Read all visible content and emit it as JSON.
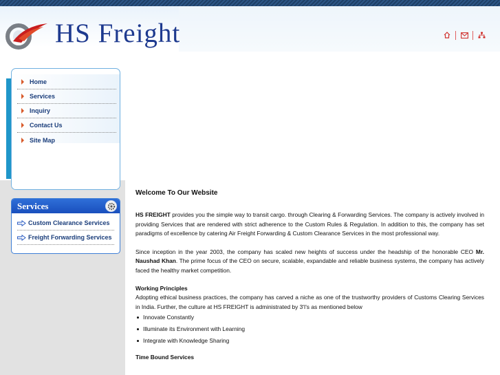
{
  "brand": {
    "name": "HS Freight",
    "logo": "hs-freight-swoosh-logo"
  },
  "header_icons": [
    {
      "name": "home-icon"
    },
    {
      "name": "mail-icon"
    },
    {
      "name": "sitemap-icon"
    }
  ],
  "nav": {
    "items": [
      {
        "label": "Home"
      },
      {
        "label": "Services"
      },
      {
        "label": "Inquiry"
      },
      {
        "label": "Contact Us"
      },
      {
        "label": "Site Map"
      }
    ]
  },
  "services_box": {
    "title": "Services",
    "icon": "gear-icon",
    "items": [
      {
        "label": "Custom Clearance Services"
      },
      {
        "label": "Freight Forwarding Services"
      }
    ]
  },
  "main": {
    "heading": "Welcome To Our Website",
    "p1_bold": "HS FREIGHT",
    "p1_text": " provides you the simple way to transit cargo. through Clearing & Forwarding Services. The company is actively involved in providing Services that are rendered with strict adherence to the Custom Rules & Regulation. In addition to this, the company has set paradigms of excellence by catering Air Freight Forwarding & Custom Clearance Services in the most professional way.",
    "p2_text_before": "Since inception in the year 2003, the company has scaled new heights of success under the headship of the honorable CEO ",
    "p2_bold": "Mr. Naushad Khan",
    "p2_text_after": ". The prime focus of the CEO on secure, scalable, expandable and reliable business systems, the company has actively faced the healthy market competition.",
    "working_principles_heading": "Working Principles",
    "working_principles_text": "Adopting ethical business practices, the company has carved a niche as one of the trustworthy providers of Customs Clearing Services in India. Further, the culture at HS FREIGHT is administrated by 3'I's as mentioned below",
    "principles": [
      {
        "label": "Innovate Constantly"
      },
      {
        "label": "Illuminate its Environment with Learning"
      },
      {
        "label": "Integrate with Knowledge Sharing"
      }
    ],
    "time_bound_heading": "Time Bound Services"
  },
  "colors": {
    "brand_blue": "#1e3a8f",
    "nav_text": "#1a3d7a",
    "accent_orange": "#d85a2a",
    "services_header": "#2f6fd8",
    "accent_bar": "#1f96c9"
  }
}
